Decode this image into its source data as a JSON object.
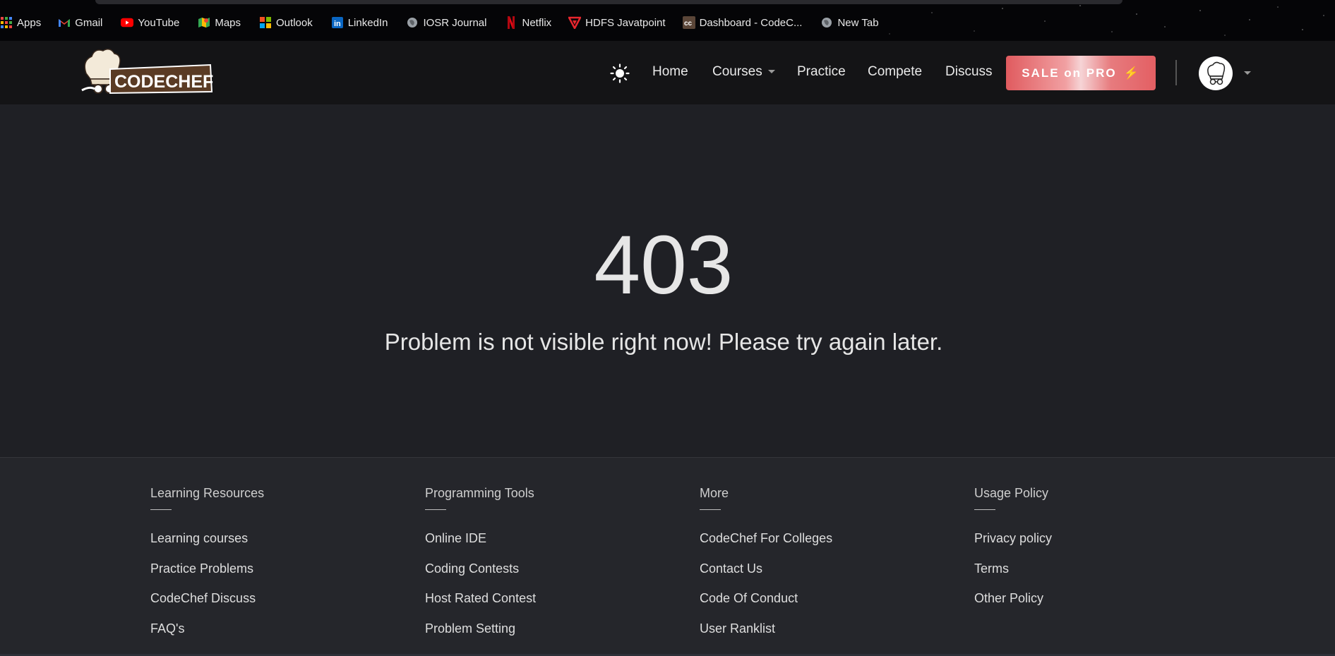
{
  "bookmarks": [
    {
      "label": "Apps",
      "icon": "apps-grid-icon"
    },
    {
      "label": "Gmail",
      "icon": "gmail-icon"
    },
    {
      "label": "YouTube",
      "icon": "youtube-icon"
    },
    {
      "label": "Maps",
      "icon": "maps-icon"
    },
    {
      "label": "Outlook",
      "icon": "outlook-icon"
    },
    {
      "label": "LinkedIn",
      "icon": "linkedin-icon"
    },
    {
      "label": "IOSR Journal",
      "icon": "globe-icon"
    },
    {
      "label": "Netflix",
      "icon": "netflix-icon"
    },
    {
      "label": "HDFS Javatpoint",
      "icon": "javatpoint-icon"
    },
    {
      "label": "Dashboard - CodeC...",
      "icon": "codechef-cc-icon"
    },
    {
      "label": "New Tab",
      "icon": "globe-icon"
    }
  ],
  "header": {
    "logo_text": "CODECHEF",
    "theme_toggle_icon": "sun-icon",
    "nav": {
      "home": "Home",
      "courses": "Courses",
      "practice": "Practice",
      "compete": "Compete",
      "discuss": "Discuss"
    },
    "sale_label": "SALE on PRO",
    "sale_icon": "lightning-icon",
    "avatar_icon": "chef-avatar-icon"
  },
  "error": {
    "code": "403",
    "message": "Problem is not visible right now! Please try again later."
  },
  "footer": {
    "columns": [
      {
        "title": "Learning Resources",
        "links": [
          "Learning courses",
          "Practice Problems",
          "CodeChef Discuss",
          "FAQ's"
        ]
      },
      {
        "title": "Programming Tools",
        "links": [
          "Online IDE",
          "Coding Contests",
          "Host Rated Contest",
          "Problem Setting"
        ]
      },
      {
        "title": "More",
        "links": [
          "CodeChef For Colleges",
          "Contact Us",
          "Code Of Conduct",
          "User Ranklist"
        ]
      },
      {
        "title": "Usage Policy",
        "links": [
          "Privacy policy",
          "Terms",
          "Other Policy"
        ]
      }
    ]
  },
  "colors": {
    "header_bg": "#141416",
    "main_bg": "#1f2025",
    "footer_bg": "#25262b",
    "sale_accent": "#e05b5f"
  }
}
